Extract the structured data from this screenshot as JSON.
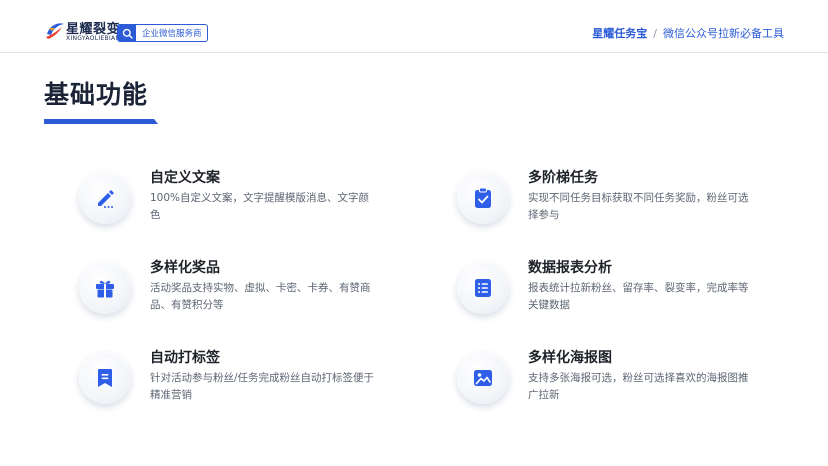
{
  "brand": {
    "name_cn": "星耀裂变",
    "name_en": "XINGYAOLIEBIAN",
    "badge": "企业微信服务商",
    "product": "星耀任务宝",
    "separator": "/",
    "slogan": "微信公众号拉新必备工具"
  },
  "page": {
    "title": "基础功能"
  },
  "colors": {
    "accent": "#2b5bd7",
    "icon_blue": "#2f5ee8"
  },
  "features": [
    {
      "title": "自定义文案",
      "desc": "100%自定义文案，文字提醒模版消息、文字颜色",
      "icon": "pencil-icon"
    },
    {
      "title": "多阶梯任务",
      "desc": "实现不同任务目标获取不同任务奖励，粉丝可选择参与",
      "icon": "clipboard-check-icon"
    },
    {
      "title": "多样化奖品",
      "desc": "活动奖品支持实物、虚拟、卡密、卡券、有赞商品、有赞积分等",
      "icon": "gift-icon"
    },
    {
      "title": "数据报表分析",
      "desc": "报表统计拉新粉丝、留存率、裂变率，完成率等关键数据",
      "icon": "list-report-icon"
    },
    {
      "title": "自动打标签",
      "desc": "针对活动参与粉丝/任务完成粉丝自动打标签便于精准营销",
      "icon": "bookmark-icon"
    },
    {
      "title": "多样化海报图",
      "desc": "支持多张海报可选，粉丝可选择喜欢的海报图推广拉新",
      "icon": "image-icon"
    }
  ]
}
